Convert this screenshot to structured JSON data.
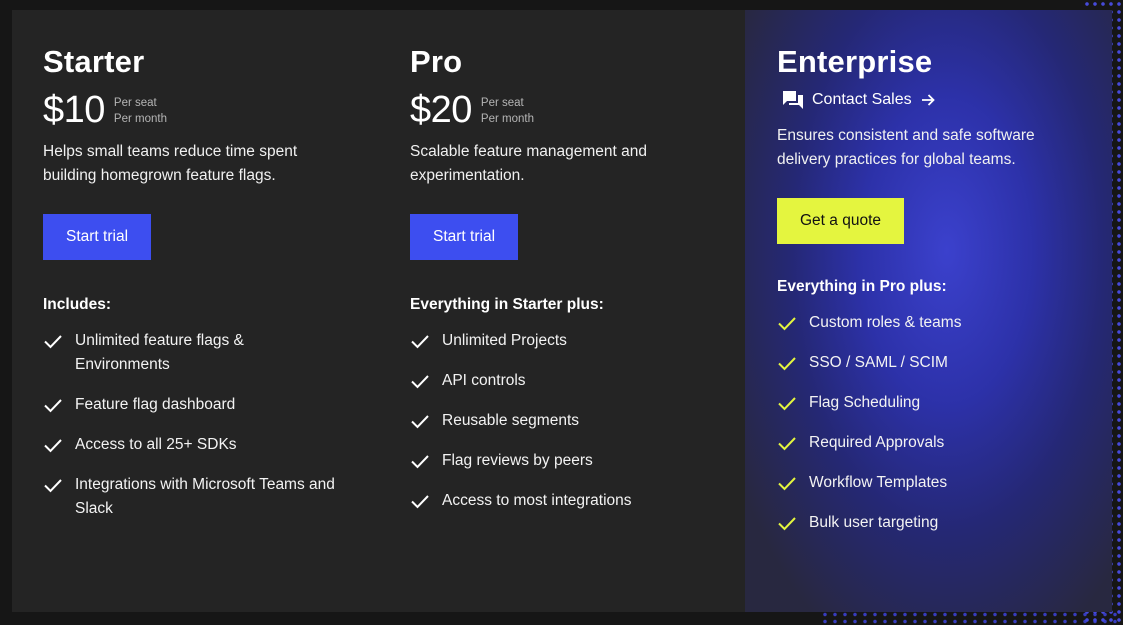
{
  "plans": [
    {
      "name": "Starter",
      "price": "$10",
      "per_seat": "Per seat",
      "per_month": "Per month",
      "description": "Helps small teams reduce time spent building homegrown feature flags.",
      "button_label": "Start trial",
      "includes_title": "Includes:",
      "features": [
        "Unlimited feature flags & Environments",
        "Feature flag dashboard",
        "Access to all 25+ SDKs",
        "Integrations with Microsoft Teams and Slack"
      ]
    },
    {
      "name": "Pro",
      "price": "$20",
      "per_seat": "Per seat",
      "per_month": "Per month",
      "description": "Scalable feature management and experimentation.",
      "button_label": "Start trial",
      "includes_title": "Everything in Starter plus:",
      "features": [
        "Unlimited Projects",
        "API controls",
        "Reusable segments",
        "Flag reviews by peers",
        "Access to most integrations"
      ]
    },
    {
      "name": "Enterprise",
      "contact_label": "Contact Sales",
      "description": "Ensures consistent and safe software delivery practices for global teams.",
      "button_label": "Get a quote",
      "includes_title": "Everything in Pro plus:",
      "features": [
        "Custom roles & teams",
        "SSO / SAML / SCIM",
        "Flag Scheduling",
        "Required Approvals",
        "Workflow Templates",
        "Bulk user targeting"
      ]
    }
  ],
  "colors": {
    "primary_button": "#3d4ef0",
    "quote_button": "#e4f53f",
    "check_default": "#ffffff",
    "check_enterprise": "#e4f53f"
  },
  "icons": {
    "check": "check-icon",
    "contact": "chat-bubbles-icon",
    "arrow": "arrow-right-icon"
  }
}
